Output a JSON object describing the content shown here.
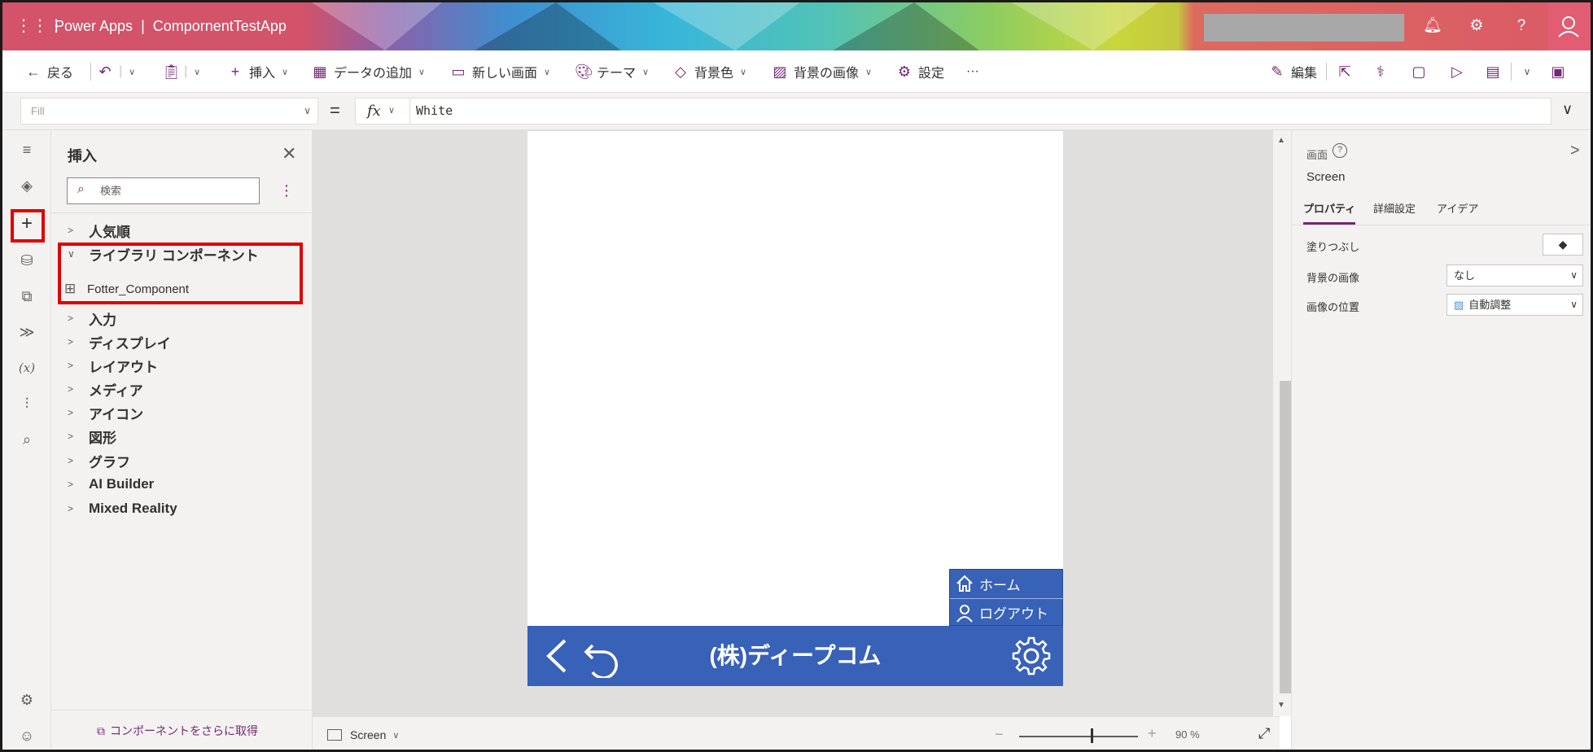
{
  "header": {
    "app_name": "Power Apps",
    "separator": "|",
    "project_name": "CompornentTestApp"
  },
  "toolbar": {
    "back": "戻る",
    "insert": "挿入",
    "add_data": "データの追加",
    "new_screen": "新しい画面",
    "theme": "テーマ",
    "bg_color": "背景色",
    "bg_image": "背景の画像",
    "settings": "設定",
    "more": "···",
    "edit": "編集"
  },
  "formula": {
    "property": "Fill",
    "equals": "=",
    "fx": "fx",
    "value": "White"
  },
  "insert_pane": {
    "title": "挿入",
    "search_placeholder": "検索",
    "categories": [
      {
        "label": "人気順"
      },
      {
        "label": "ライブラリ コンポーネント"
      },
      {
        "label": "入力"
      },
      {
        "label": "ディスプレイ"
      },
      {
        "label": "レイアウト"
      },
      {
        "label": "メディア"
      },
      {
        "label": "アイコン"
      },
      {
        "label": "図形"
      },
      {
        "label": "グラフ"
      },
      {
        "label": "AI Builder"
      },
      {
        "label": "Mixed Reality"
      }
    ],
    "library_item": "Fotter_Component",
    "get_more": "コンポーネントをさらに取得"
  },
  "canvas": {
    "company": "(株)ディープコム",
    "menu_home": "ホーム",
    "menu_logout": "ログアウト",
    "footer_color": "#3861b8"
  },
  "statusbar": {
    "screen": "Screen",
    "zoom_minus": "−",
    "zoom_plus": "+",
    "zoom_value": "90 %",
    "zoom_fraction": 0.6
  },
  "properties": {
    "type_label": "画面",
    "name": "Screen",
    "tabs": [
      "プロパティ",
      "詳細設定",
      "アイデア"
    ],
    "fill_label": "塗りつぶし",
    "bg_image_label": "背景の画像",
    "bg_image_value": "なし",
    "image_position_label": "画像の位置",
    "image_position_value": "自動調整"
  },
  "colors": {
    "accent": "#742774",
    "highlight": "#e00000"
  }
}
